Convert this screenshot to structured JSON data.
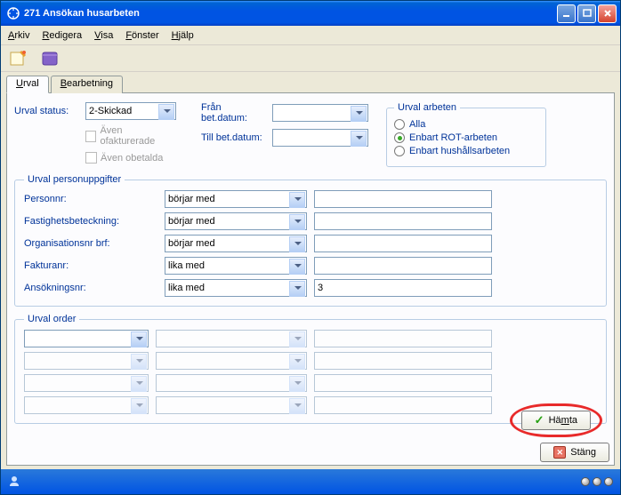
{
  "window": {
    "title": "271 Ansökan husarbeten"
  },
  "menu": {
    "arkiv": "Arkiv",
    "redigera": "Redigera",
    "visa": "Visa",
    "fonster": "Fönster",
    "hjalp": "Hjälp"
  },
  "tabs": {
    "urval": "Urval",
    "bearbetning": "Bearbetning"
  },
  "urval_status": {
    "label": "Urval status:",
    "value": "2-Skickad"
  },
  "aven_ofaktur": "Även ofakturerade",
  "aven_obetalda": "Även obetalda",
  "fran_bet": {
    "label": "Från bet.datum:",
    "value": ""
  },
  "till_bet": {
    "label": "Till bet.datum:",
    "value": ""
  },
  "arbeten": {
    "legend": "Urval arbeten",
    "alla": "Alla",
    "rot": "Enbart ROT-arbeten",
    "hush": "Enbart hushållsarbeten"
  },
  "person": {
    "legend": "Urval personuppgifter",
    "labels": {
      "personnr": "Personnr:",
      "fastighet": "Fastighetsbeteckning:",
      "orgnr": "Organisationsnr brf:",
      "fakturanr": "Fakturanr:",
      "ansokningsnr": "Ansökningsnr:"
    },
    "ops": {
      "borjar": "börjar med",
      "lika": "lika med"
    },
    "values": {
      "personnr": "",
      "fastighet": "",
      "orgnr": "",
      "fakturanr": "",
      "ansokningsnr": "3"
    }
  },
  "order": {
    "legend": "Urval order"
  },
  "buttons": {
    "hamta": "Hämta",
    "stang": "Stäng"
  }
}
